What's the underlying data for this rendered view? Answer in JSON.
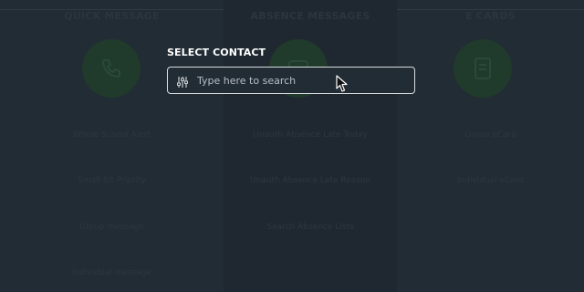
{
  "columns": [
    {
      "title": "QUICK MESSAGE",
      "icon": "phone-icon",
      "items": [
        "Whole School Alert",
        "Small Bit Priority",
        "Group message",
        "Individual message"
      ]
    },
    {
      "title": "ABSENCE MESSAGES",
      "icon": "message-icon",
      "items": [
        "Unauth Absence Late Today",
        "Unauth Absence Late Reason",
        "Search Absence Lists"
      ]
    },
    {
      "title": "E CARDS",
      "icon": "card-icon",
      "items": [
        "Group eCard",
        "Individual eCard"
      ]
    }
  ],
  "overlay": {
    "label": "SELECT CONTACT",
    "search_placeholder": "Type here to search",
    "filter_icon": "filter-sliders-icon"
  },
  "colors": {
    "background": "#222c34",
    "overlay_text": "#ffffff",
    "search_border": "#d8dcdf",
    "icon_circle": "#203a2b"
  }
}
